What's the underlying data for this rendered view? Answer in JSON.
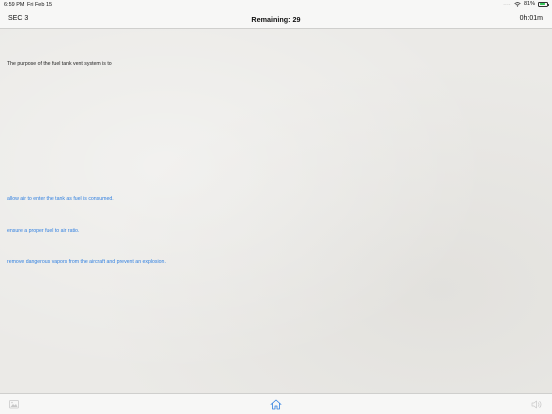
{
  "status_bar": {
    "time": "6:59 PM",
    "date": "Fri Feb 15",
    "signal_dots": "....",
    "battery_percent": "81%",
    "battery_level": 0.81,
    "battery_color": "#35c759"
  },
  "header": {
    "section": "SEC 3",
    "remaining": "Remaining: 29",
    "timer": "0h:01m"
  },
  "question": {
    "text": "The purpose of the fuel tank vent system is to"
  },
  "answers": [
    {
      "text": "allow air to enter the tank as fuel is consumed."
    },
    {
      "text": "ensure a proper fuel to air ratio."
    },
    {
      "text": "remove dangerous vapors from the aircraft and prevent an explosion."
    }
  ],
  "colors": {
    "answer_link": "#2f7fe0",
    "home_icon": "#2f7fe0",
    "disabled_icon": "#c8c8c8"
  },
  "toolbar": {
    "left_icon": "image-icon",
    "center_icon": "home-icon",
    "right_icon": "sound-icon"
  }
}
